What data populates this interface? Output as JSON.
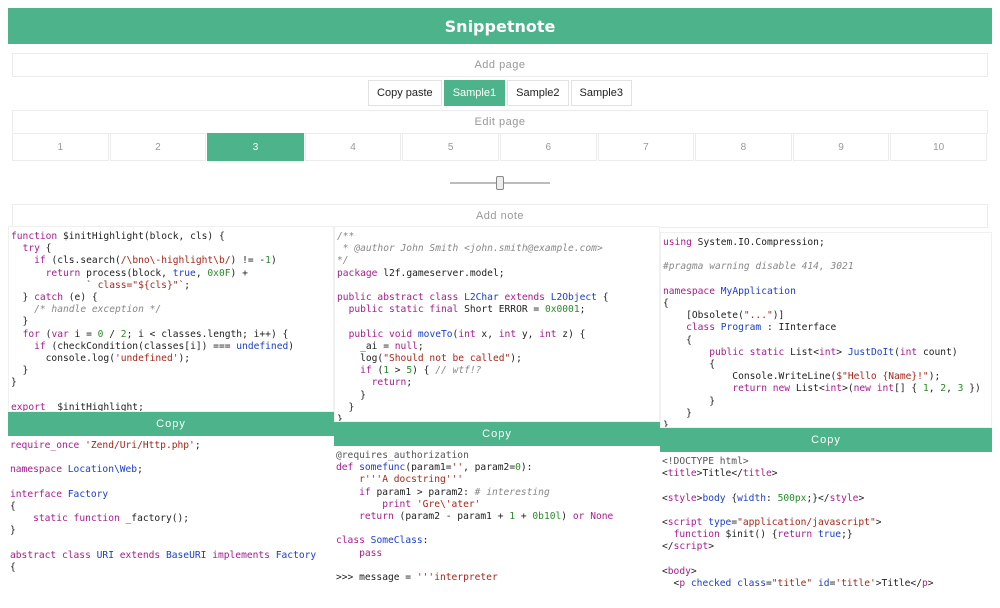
{
  "app": {
    "title": "Snippetnote"
  },
  "bars": {
    "add_page": "Add page",
    "edit_page": "Edit page",
    "add_note": "Add note"
  },
  "tabs": [
    {
      "label": "Copy paste",
      "active": false
    },
    {
      "label": "Sample1",
      "active": true
    },
    {
      "label": "Sample2",
      "active": false
    },
    {
      "label": "Sample3",
      "active": false
    }
  ],
  "pages": [
    "1",
    "2",
    "3",
    "4",
    "5",
    "6",
    "7",
    "8",
    "9",
    "10"
  ],
  "active_page": "3",
  "slider": {
    "value": 0.5
  },
  "notes": {
    "copy_label": "Copy"
  },
  "colors": {
    "accent": "#4cb38a"
  }
}
